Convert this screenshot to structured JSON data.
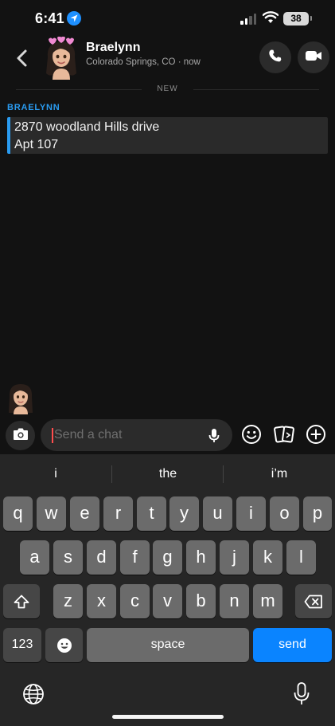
{
  "status_bar": {
    "time": "6:41",
    "battery": "38"
  },
  "header": {
    "back_icon": "chevron-left-icon",
    "contact_name": "Braelynn",
    "contact_subtitle": "Colorado Springs, CO · now",
    "call_icon": "phone-icon",
    "video_icon": "video-camera-icon"
  },
  "divider": {
    "label": "NEW"
  },
  "conversation": {
    "sender": "BRAELYNN",
    "message_lines": [
      "2870 woodland Hills drive",
      "Apt 107"
    ],
    "accent_color": "#2a9bf0"
  },
  "chat_bar": {
    "placeholder": "Send a chat",
    "camera_icon": "camera-icon",
    "mic_icon": "microphone-icon",
    "emoji_icon": "smiley-icon",
    "stickers_icon": "cards-icon",
    "plus_icon": "plus-circle-icon"
  },
  "keyboard": {
    "suggestions": [
      "i",
      "the",
      "i’m"
    ],
    "row1": [
      "q",
      "w",
      "e",
      "r",
      "t",
      "y",
      "u",
      "i",
      "o",
      "p"
    ],
    "row2": [
      "a",
      "s",
      "d",
      "f",
      "g",
      "h",
      "j",
      "k",
      "l"
    ],
    "row3": [
      "z",
      "x",
      "c",
      "v",
      "b",
      "n",
      "m"
    ],
    "numbers_label": "123",
    "space_label": "space",
    "send_label": "send",
    "send_color": "#0a84ff"
  }
}
